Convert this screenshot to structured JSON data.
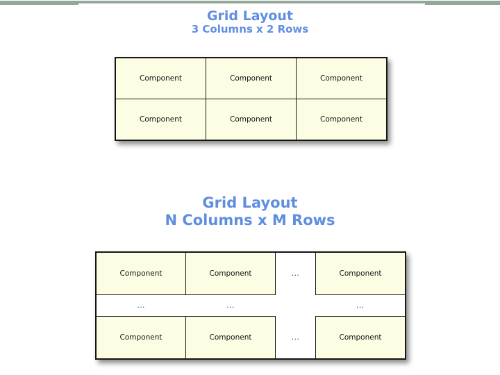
{
  "page": {
    "background_color": "#ffffff",
    "accent_band_color": "#94a79b",
    "title_color": "#5f8ee0",
    "cell_fill_color": "#fdfde4",
    "cell_border_color": "#151515",
    "dots_color": "#1f3864"
  },
  "sections": [
    {
      "id": "three-by-two",
      "title_line_1": "Grid Layout",
      "title_line_2": "3 Columns x 2 Rows",
      "grid": {
        "columns": 3,
        "rows": 2,
        "cells": [
          [
            "Component",
            "Component",
            "Component"
          ],
          [
            "Component",
            "Component",
            "Component"
          ]
        ]
      }
    },
    {
      "id": "n-by-m",
      "title_line_1": "Grid Layout",
      "title_line_2": "N Columns x M Rows",
      "grid": {
        "columns": 4,
        "rows": 3,
        "cells": [
          [
            "Component",
            "Component",
            "...",
            "Component"
          ],
          [
            "...",
            "...",
            "",
            "..."
          ],
          [
            "Component",
            "Component",
            "...",
            "Component"
          ]
        ]
      }
    }
  ],
  "labels": {
    "component": "Component",
    "ellipsis": "..."
  }
}
